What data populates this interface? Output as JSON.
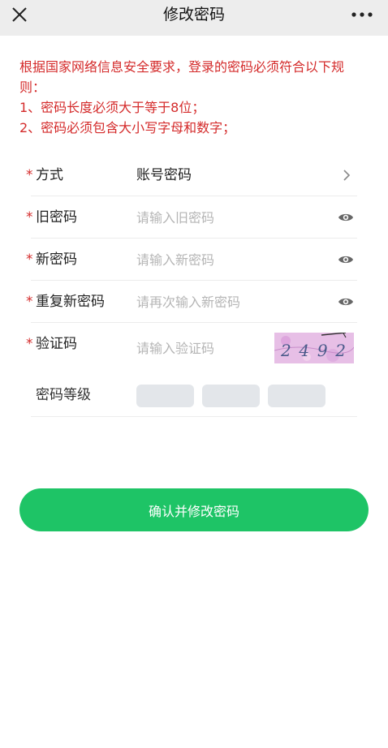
{
  "navbar": {
    "title": "修改密码",
    "close_icon": "close-icon",
    "more_icon": "more-horizontal-icon"
  },
  "notice": {
    "line1": "根据国家网络信息安全要求，登录的密码必须符合以下规则：",
    "line2": "1、密码长度必须大于等于8位；",
    "line3": "2、密码必须包含大小写字母和数字；",
    "color": "#d42b2b"
  },
  "form": {
    "required_mark": "*",
    "method": {
      "label": "方式",
      "value": "账号密码"
    },
    "old_password": {
      "label": "旧密码",
      "placeholder": "请输入旧密码"
    },
    "new_password": {
      "label": "新密码",
      "placeholder": "请输入新密码"
    },
    "repeat_password": {
      "label": "重复新密码",
      "placeholder": "请再次输入新密码"
    },
    "captcha": {
      "label": "验证码",
      "placeholder": "请输入验证码",
      "image_text": "2492"
    },
    "strength": {
      "label": "密码等级",
      "level": 0,
      "max_level": 3
    }
  },
  "submit": {
    "label": "确认并修改密码",
    "color": "#1ec466"
  }
}
